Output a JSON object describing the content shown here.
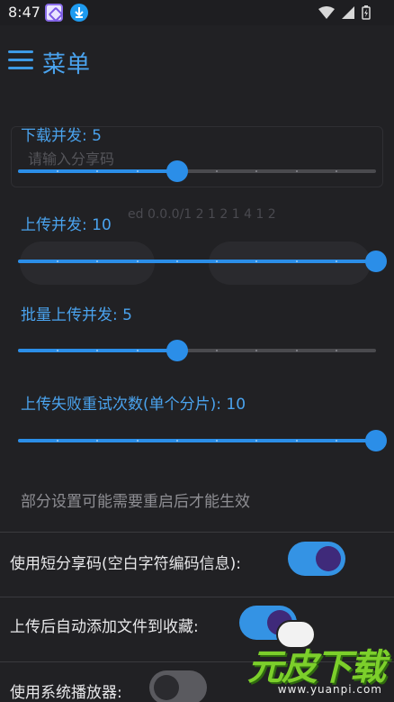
{
  "status_bar": {
    "time": "8:47"
  },
  "toolbar": {
    "title": "菜单"
  },
  "background": {
    "input_placeholder": "请输入分享码",
    "faded_line": "ed 0.0.0/1 2 1 2 1 4 1 2"
  },
  "sliders": [
    {
      "label": "下载并发: 5",
      "value": 5,
      "min": 1,
      "max": 10
    },
    {
      "label": "上传并发: 10",
      "value": 10,
      "min": 1,
      "max": 10
    },
    {
      "label": "批量上传并发: 5",
      "value": 5,
      "min": 1,
      "max": 10
    },
    {
      "label": "上传失败重试次数(单个分片): 10",
      "value": 10,
      "min": 1,
      "max": 10
    }
  ],
  "hint": "部分设置可能需要重启后才能生效",
  "switches": [
    {
      "label": "使用短分享码(空白字符编码信息):",
      "on": true
    },
    {
      "label": "上传后自动添加文件到收藏:",
      "on": true
    },
    {
      "label": "使用系统播放器:",
      "on": false
    }
  ],
  "watermark": {
    "title": "元皮下载",
    "url": "www.yuanpi.com"
  },
  "colors": {
    "accent": "#2b8ee8",
    "background": "#212124",
    "switch_knob_on": "#3f2a7a"
  }
}
